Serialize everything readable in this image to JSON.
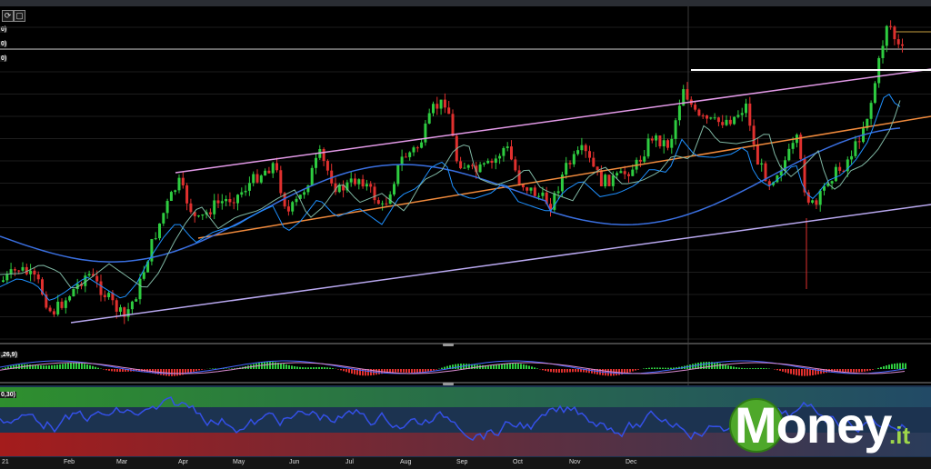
{
  "toolbar": {
    "refresh_icon": "refresh-icon",
    "square_icon": "square-icon"
  },
  "price_labels": [
    "0)",
    "0)",
    "0)"
  ],
  "macd_label": ",26,9)",
  "rsi_label": "0,30)",
  "month_labels": [
    "21",
    "Feb",
    "Mar",
    "Apr",
    "May",
    "Jun",
    "Jul",
    "Aug",
    "Sep",
    "Oct",
    "Nov",
    "Dec"
  ],
  "watermark": {
    "text": "Money",
    "suffix": ".it"
  },
  "colors": {
    "background": "#000000",
    "bull": "#2ecc40",
    "bear": "#e0302e",
    "channel_upper": "#e39ae8",
    "channel_lower": "#b9a8f0",
    "mid_line": "#f08a3c",
    "ma_fast": "#1e90ff",
    "ma_slow": "#3a6fe0",
    "resistance": "#ffffff",
    "rsi_line": "#3450e8",
    "brand_green": "#4ea82a"
  }
}
